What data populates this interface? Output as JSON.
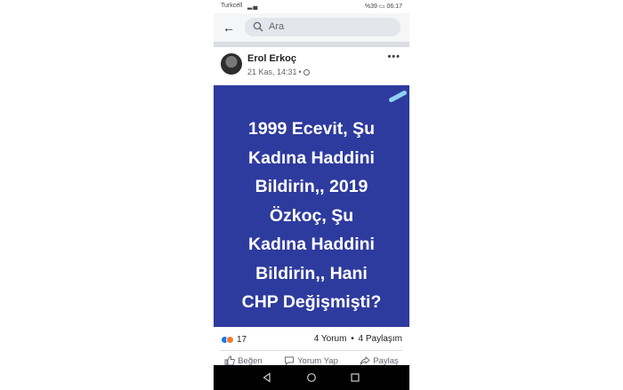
{
  "status_bar": {
    "carrier": "Turkcell",
    "battery": "%39",
    "time": "06:17"
  },
  "search": {
    "placeholder": "Ara",
    "icons": [
      "back-arrow-icon",
      "search-icon"
    ]
  },
  "post": {
    "author": "Erol Erkoç",
    "time": "21 Kas, 14:31",
    "meta_dot": "•",
    "image_text_lines": [
      "1999 Ecevit, Şu",
      "Kadına Haddini",
      "Bildirin,, 2019",
      "Özkoç, Şu",
      "Kadına Haddini",
      "Bildirin,, Hani",
      "CHP Değişmişti?"
    ],
    "image_bg_color": "#2e3b9e",
    "reaction_count": "17",
    "comments": "4 Yorum",
    "shares": "4 Paylaşım",
    "separator": "•"
  },
  "actions": {
    "like": "Beğen",
    "comment": "Yorum Yap",
    "share": "Paylaş"
  },
  "colors": {
    "accent": "#1877f2",
    "angry": "#f07e2a"
  }
}
